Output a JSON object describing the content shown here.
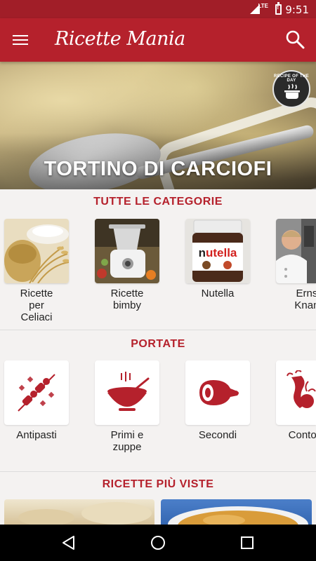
{
  "status": {
    "time": "9:51",
    "network": "LTE"
  },
  "app": {
    "title": "Ricette Mania",
    "menu_icon": "hamburger-menu-icon",
    "search_icon": "search-icon",
    "accent_color": "#b5212c"
  },
  "hero": {
    "title": "TORTINO DI CARCIOFI",
    "badge_text": "RECIPE OF THE DAY"
  },
  "categories": {
    "title": "TUTTE LE CATEGORIE",
    "items": [
      {
        "label": "Ricette per Celiaci",
        "lines": [
          "Ricette",
          "per",
          "Celiaci"
        ]
      },
      {
        "label": "Ricette bimby",
        "lines": [
          "Ricette",
          "bimby"
        ]
      },
      {
        "label": "Nutella",
        "lines": [
          "Nutella"
        ]
      },
      {
        "label": "Ernst Knam",
        "lines": [
          "Ernst",
          "Knam"
        ]
      }
    ]
  },
  "portate": {
    "title": "PORTATE",
    "items": [
      {
        "label": "Antipasti",
        "lines": [
          "Antipasti"
        ],
        "icon": "skewer-icon"
      },
      {
        "label": "Primi e zuppe",
        "lines": [
          "Primi e",
          "zuppe"
        ],
        "icon": "soup-bowl-icon"
      },
      {
        "label": "Secondi",
        "lines": [
          "Secondi"
        ],
        "icon": "ham-leg-icon"
      },
      {
        "label": "Contorni",
        "lines": [
          "Contorni"
        ],
        "icon": "vegetables-icon"
      }
    ]
  },
  "most_viewed": {
    "title": "RICETTE PIÙ VISTE"
  },
  "nav": {
    "back_icon": "back-triangle-icon",
    "home_icon": "home-circle-icon",
    "recents_icon": "recents-square-icon"
  }
}
